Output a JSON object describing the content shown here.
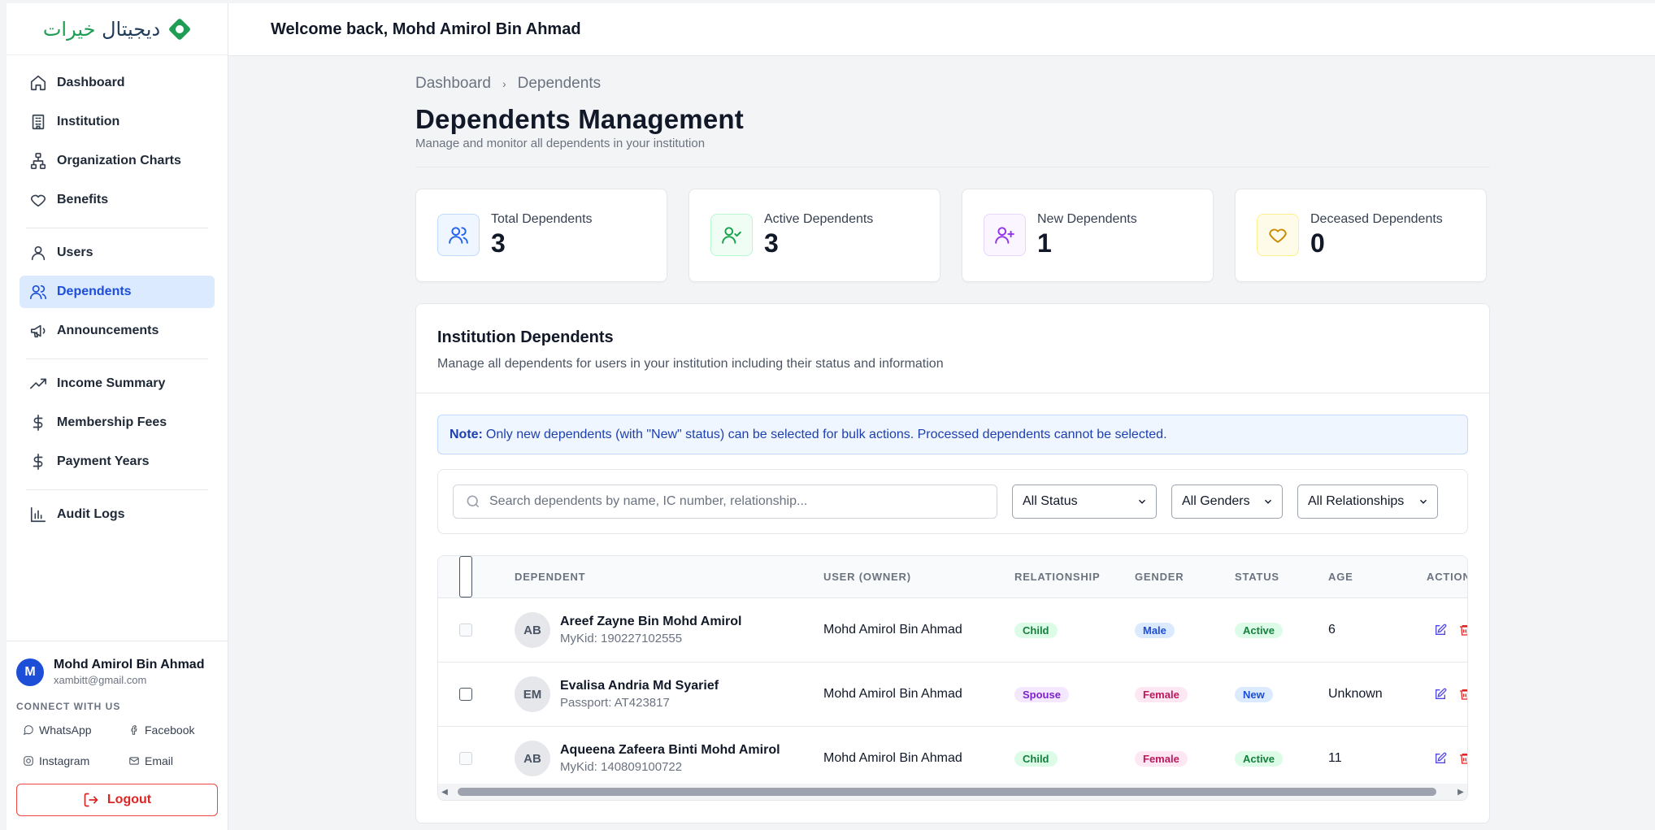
{
  "header": {
    "welcome": "Welcome back, Mohd Amirol Bin Ahmad"
  },
  "logo": {
    "text_main": "ديجيتال",
    "text_accent": "خيرات"
  },
  "sidebar": {
    "items": [
      {
        "label": "Dashboard",
        "icon": "home-icon"
      },
      {
        "label": "Institution",
        "icon": "building-icon"
      },
      {
        "label": "Organization Charts",
        "icon": "org-chart-icon"
      },
      {
        "label": "Benefits",
        "icon": "heart-icon"
      },
      {
        "label": "Users",
        "icon": "user-icon"
      },
      {
        "label": "Dependents",
        "icon": "users-icon",
        "active": true
      },
      {
        "label": "Announcements",
        "icon": "megaphone-icon"
      },
      {
        "label": "Income Summary",
        "icon": "trending-up-icon"
      },
      {
        "label": "Membership Fees",
        "icon": "dollar-icon"
      },
      {
        "label": "Payment Years",
        "icon": "dollar-icon"
      },
      {
        "label": "Audit Logs",
        "icon": "bar-chart-icon"
      }
    ],
    "user": {
      "initial": "M",
      "name": "Mohd Amirol Bin Ahmad",
      "email": "xambitt@gmail.com"
    },
    "connect_label": "CONNECT WITH US",
    "social": {
      "whatsapp": "WhatsApp",
      "facebook": "Facebook",
      "instagram": "Instagram",
      "email": "Email"
    },
    "logout": "Logout"
  },
  "breadcrumb": {
    "root": "Dashboard",
    "current": "Dependents"
  },
  "page": {
    "title": "Dependents Management",
    "subtitle": "Manage and monitor all dependents in your institution"
  },
  "stats": [
    {
      "label": "Total Dependents",
      "value": "3",
      "icon": "users-icon",
      "color": "#2563eb",
      "bg": "#eff6ff",
      "border": "#bfdbfe"
    },
    {
      "label": "Active Dependents",
      "value": "3",
      "icon": "user-check-icon",
      "color": "#16a34a",
      "bg": "#f0fdf4",
      "border": "#bbf7d0"
    },
    {
      "label": "New Dependents",
      "value": "1",
      "icon": "user-plus-icon",
      "color": "#9333ea",
      "bg": "#faf5ff",
      "border": "#e9d5ff"
    },
    {
      "label": "Deceased Dependents",
      "value": "0",
      "icon": "heart-icon",
      "color": "#ca8a04",
      "bg": "#fefce8",
      "border": "#fef08a"
    }
  ],
  "panel": {
    "title": "Institution Dependents",
    "subtitle": "Manage all dependents for users in your institution including their status and information",
    "note_label": "Note:",
    "note_text": "Only new dependents (with \"New\" status) can be selected for bulk actions. Processed dependents cannot be selected."
  },
  "filters": {
    "search_placeholder": "Search dependents by name, IC number, relationship...",
    "status": "All Status",
    "gender": "All Genders",
    "relationship": "All Relationships"
  },
  "table": {
    "columns": [
      "DEPENDENT",
      "USER (OWNER)",
      "RELATIONSHIP",
      "GENDER",
      "STATUS",
      "AGE",
      "ACTIONS"
    ],
    "rows": [
      {
        "initials": "AB",
        "name": "Areef Zayne Bin Mohd Amirol",
        "id": "MyKid: 190227102555",
        "owner": "Mohd Amirol Bin Ahmad",
        "relationship": "Child",
        "gender": "Male",
        "status": "Active",
        "age": "6",
        "selectable": false
      },
      {
        "initials": "EM",
        "name": "Evalisa Andria Md Syarief",
        "id": "Passport: AT423817",
        "owner": "Mohd Amirol Bin Ahmad",
        "relationship": "Spouse",
        "gender": "Female",
        "status": "New",
        "age": "Unknown",
        "selectable": true
      },
      {
        "initials": "AB",
        "name": "Aqueena Zafeera Binti Mohd Amirol",
        "id": "MyKid: 140809100722",
        "owner": "Mohd Amirol Bin Ahmad",
        "relationship": "Child",
        "gender": "Female",
        "status": "Active",
        "age": "11",
        "selectable": false
      }
    ]
  },
  "colors": {
    "accent": "#1d4ed8",
    "badge_child": {
      "bg": "#dcfce7",
      "fg": "#15803d"
    },
    "badge_spouse": {
      "bg": "#f3e8ff",
      "fg": "#7e22ce"
    },
    "badge_male": {
      "bg": "#dbeafe",
      "fg": "#1d4ed8"
    },
    "badge_female": {
      "bg": "#fce7f3",
      "fg": "#be185d"
    },
    "badge_active": {
      "bg": "#dcfce7",
      "fg": "#15803d"
    },
    "badge_new": {
      "bg": "#dbeafe",
      "fg": "#1d4ed8"
    }
  }
}
